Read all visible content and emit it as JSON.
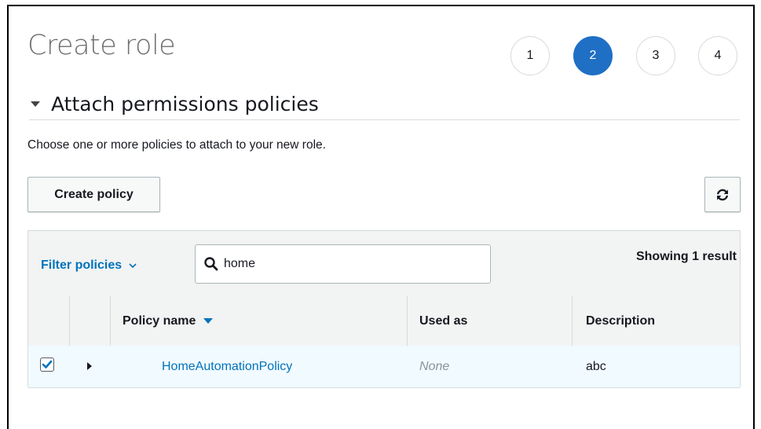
{
  "page": {
    "title": "Create role"
  },
  "steps": [
    {
      "label": "1",
      "active": false
    },
    {
      "label": "2",
      "active": true
    },
    {
      "label": "3",
      "active": false
    },
    {
      "label": "4",
      "active": false
    }
  ],
  "section": {
    "title": "Attach permissions policies",
    "description": "Choose one or more policies to attach to your new role."
  },
  "toolbar": {
    "create_policy_label": "Create policy",
    "refresh_icon": "refresh-icon"
  },
  "filter": {
    "label": "Filter policies",
    "search_value": "home",
    "search_icon": "search-icon",
    "result_count": "Showing 1 result"
  },
  "table": {
    "columns": [
      "Policy name",
      "Used as",
      "Description"
    ],
    "rows": [
      {
        "selected": true,
        "policy_name": "HomeAutomationPolicy",
        "used_as": "None",
        "description": "abc"
      }
    ]
  },
  "colors": {
    "accent": "#1f6fc5",
    "link": "#0073bb",
    "selected_row_bg": "#f1faff",
    "header_bg": "#f2f3f3"
  }
}
